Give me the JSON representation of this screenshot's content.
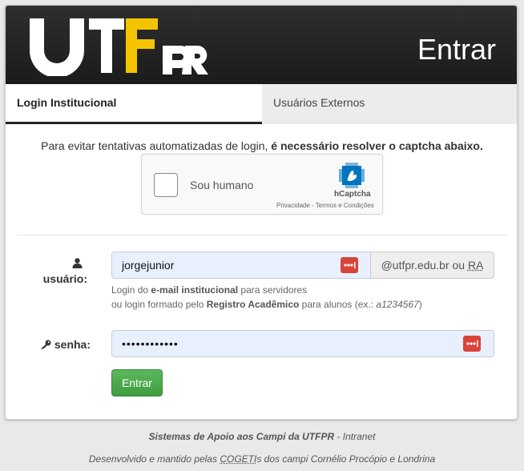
{
  "header": {
    "logo_text": "UTFPR",
    "title": "Entrar"
  },
  "tabs": [
    {
      "label": "Login Institucional",
      "active": true
    },
    {
      "label": "Usuários Externos",
      "active": false
    }
  ],
  "captcha": {
    "message_prefix": "Para evitar tentativas automatizadas de login, ",
    "message_bold": "é necessário resolver o captcha abaixo.",
    "checkbox_label": "Sou humano",
    "brand": "hCaptcha",
    "links": "Privacidade - Termos e Condições"
  },
  "form": {
    "user_label": "usuário:",
    "user_value": "jorgejunior",
    "user_suffix_prefix": "@utfpr.edu.br ou ",
    "user_suffix_abbr": "RA",
    "help_line1_a": "Login do ",
    "help_line1_b": "e-mail institucional",
    "help_line1_c": " para servidores",
    "help_line2_a": "ou login formado pelo ",
    "help_line2_b": "Registro Acadêmico",
    "help_line2_c": " para alunos (ex.: ",
    "help_line2_d": "a1234567",
    "help_line2_e": ")",
    "pass_label": "senha:",
    "pass_value": "••••••••••••",
    "submit_label": "Entrar"
  },
  "footer": {
    "line1_bold": "Sistemas de Apoio aos Campi da UTFPR",
    "line1_rest": " - Intranet",
    "line2_a": "Desenvolvido e mantido pelas ",
    "line2_abbr": "COGETI",
    "line2_b": "s dos campi Cornélio Procópio e Londrina"
  },
  "colors": {
    "header_bg": "#222222",
    "logo_accent": "#f5c400",
    "submit": "#4cae4c",
    "password_manager": "#d9443a"
  },
  "icons": [
    "user-icon",
    "key-icon",
    "password-manager-icon",
    "hcaptcha-logo-icon"
  ]
}
